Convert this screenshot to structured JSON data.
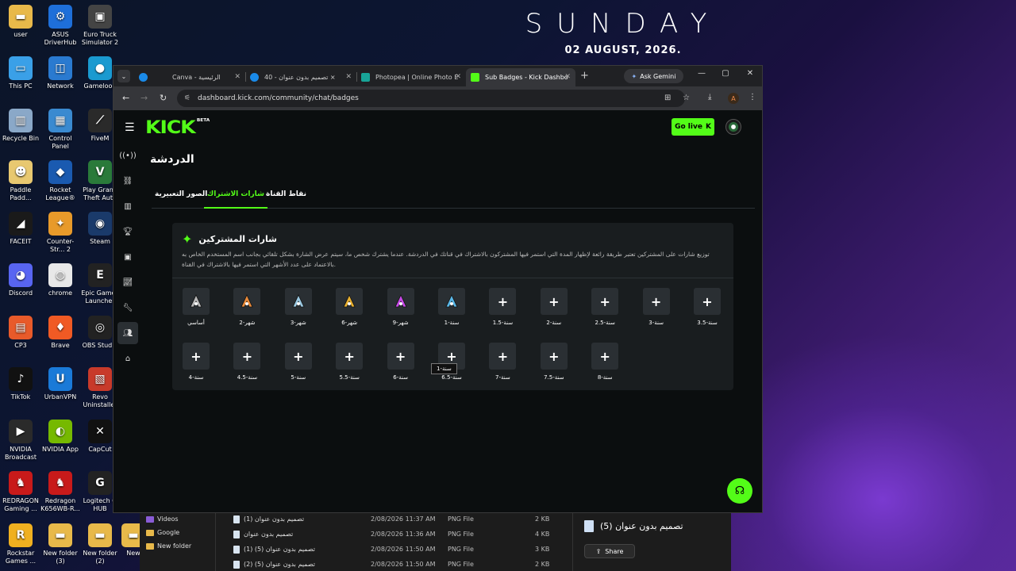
{
  "clock": {
    "day": "SUNDAY",
    "date": "02 AUGUST, 2026."
  },
  "desktop_icons": [
    {
      "label": "user",
      "color": "#e8b94a",
      "glyph": "▬"
    },
    {
      "label": "ASUS DriverHub",
      "color": "#1e6fd9",
      "glyph": "⚙"
    },
    {
      "label": "Euro Truck Simulator 2",
      "color": "#444",
      "glyph": "▣"
    },
    {
      "label": "This PC",
      "color": "#3aa0e8",
      "glyph": "▭"
    },
    {
      "label": "Network",
      "color": "#2a7ad0",
      "glyph": "◫"
    },
    {
      "label": "Gameloop",
      "color": "#1a9ad0",
      "glyph": "●"
    },
    {
      "label": "Recycle Bin",
      "color": "#8aa8c8",
      "glyph": "▥"
    },
    {
      "label": "Control Panel",
      "color": "#3a8ad0",
      "glyph": "▦"
    },
    {
      "label": "FiveM",
      "color": "#2a2a2a",
      "glyph": "⟋"
    },
    {
      "label": "Paddle Padd...",
      "color": "#e8c870",
      "glyph": "☻"
    },
    {
      "label": "Rocket League®",
      "color": "#1a5ab0",
      "glyph": "◆"
    },
    {
      "label": "Play Grand Theft Auto",
      "color": "#2a7a3a",
      "glyph": "V"
    },
    {
      "label": "FACEIT",
      "color": "#1a1a1a",
      "glyph": "◢"
    },
    {
      "label": "Counter-Str... 2",
      "color": "#e89a2a",
      "glyph": "✦"
    },
    {
      "label": "Steam",
      "color": "#1a3a6a",
      "glyph": "◉"
    },
    {
      "label": "Discord",
      "color": "#5865f2",
      "glyph": "◕"
    },
    {
      "label": "chrome",
      "color": "#e8e8e8",
      "glyph": "◍"
    },
    {
      "label": "Epic Games Launcher",
      "color": "#222",
      "glyph": "E"
    },
    {
      "label": "CP3",
      "color": "#e85a2a",
      "glyph": "▤"
    },
    {
      "label": "Brave",
      "color": "#f05a24",
      "glyph": "♦"
    },
    {
      "label": "OBS Studio",
      "color": "#222",
      "glyph": "◎"
    },
    {
      "label": "TikTok",
      "color": "#111",
      "glyph": "♪"
    },
    {
      "label": "UrbanVPN",
      "color": "#1a7ad8",
      "glyph": "U"
    },
    {
      "label": "Revo Uninstaller",
      "color": "#c83a2a",
      "glyph": "▧"
    },
    {
      "label": "NVIDIA Broadcast",
      "color": "#2a2a2a",
      "glyph": "▶"
    },
    {
      "label": "NVIDIA App",
      "color": "#76b900",
      "glyph": "◐"
    },
    {
      "label": "CapCut",
      "color": "#111",
      "glyph": "✕"
    },
    {
      "label": "REDRAGON Gaming ...",
      "color": "#c81a1a",
      "glyph": "♞"
    },
    {
      "label": "Redragon K656WB-R...",
      "color": "#c81a1a",
      "glyph": "♞"
    },
    {
      "label": "Logitech G HUB",
      "color": "#222",
      "glyph": "G"
    },
    {
      "label": "Rockstar Games ...",
      "color": "#f0b020",
      "glyph": "R"
    },
    {
      "label": "New folder (3)",
      "color": "#e8b94a",
      "glyph": "▬"
    },
    {
      "label": "New folder (2)",
      "color": "#e8b94a",
      "glyph": "▬"
    },
    {
      "label": "New",
      "color": "#e8b94a",
      "glyph": "▬"
    }
  ],
  "explorer": {
    "nav": [
      "Videos",
      "Google",
      "New folder"
    ],
    "files": [
      {
        "name": "تصميم بدون عنوان (1)",
        "date": "2/08/2026 11:37 AM",
        "type": "PNG File",
        "size": "2 KB"
      },
      {
        "name": "تصميم بدون عنوان",
        "date": "2/08/2026 11:36 AM",
        "type": "PNG File",
        "size": "4 KB"
      },
      {
        "name": "تصميم بدون عنوان (5) (1)",
        "date": "2/08/2026 11:50 AM",
        "type": "PNG File",
        "size": "3 KB"
      },
      {
        "name": "تصميم بدون عنوان (5) (2)",
        "date": "2/08/2026 11:50 AM",
        "type": "PNG File",
        "size": "2 KB"
      }
    ],
    "preview_title": "تصميم بدون عنوان (5)",
    "share_label": "Share"
  },
  "browser": {
    "tabs": [
      {
        "title": "Canva - الرئيسية",
        "favicon": "#1a8ae8"
      },
      {
        "title": "تصميم بدون عنوان - 40 ×",
        "favicon": "#1a8ae8"
      },
      {
        "title": "Photopea | Online Photo E",
        "favicon": "#18a497"
      },
      {
        "title": "Sub Badges - Kick Dashbo",
        "favicon": "#53fc18"
      }
    ],
    "gemini_label": "Ask Gemini",
    "url": "dashboard.kick.com/community/chat/badges",
    "profile_initial": "A"
  },
  "kick": {
    "logo": "KICK",
    "logo_sup": "BETA",
    "go_live": "Go live",
    "page_title": "الدردشة",
    "tabs": [
      "نقاط القناة",
      "شارات الاشتراك",
      "الصور التعبيرية"
    ],
    "card_title": "شارات المشتركين",
    "card_desc": "توزيع شارات على المشتركين تعتبر طريقة رائعة لإظهار المدة التي استمر فيها المشتركون بالاشتراك في قناتك في الدردشة. عندما يشترك شخص ما، سيتم عرض الشارة بشكل تلقائي بجانب اسم المستخدم الخاص به بالاعتماد على عدد الأشهر التي استمر فيها بالاشتراك في القناة.",
    "badges_row1": [
      {
        "label": "أساسي",
        "color": "#b8b8b8"
      },
      {
        "label": "شهر-2",
        "color": "#e88a3a"
      },
      {
        "label": "شهر-3",
        "color": "#9ac8e0"
      },
      {
        "label": "شهر-6",
        "color": "#e8b030"
      },
      {
        "label": "شهر-9",
        "color": "#c84ae8"
      },
      {
        "label": "سنة-1",
        "color": "#5ab8e8"
      },
      {
        "label": "سنة-1.5",
        "color": ""
      },
      {
        "label": "سنة-2",
        "color": ""
      },
      {
        "label": "سنة-2.5",
        "color": ""
      },
      {
        "label": "سنة-3",
        "color": ""
      },
      {
        "label": "سنة-3.5",
        "color": ""
      }
    ],
    "badges_row2": [
      {
        "label": "سنة-4"
      },
      {
        "label": "سنة-4.5"
      },
      {
        "label": "سنة-5"
      },
      {
        "label": "سنة-5.5"
      },
      {
        "label": "سنة-6"
      },
      {
        "label": "سنة-6.5"
      },
      {
        "label": "سنة-7"
      },
      {
        "label": "سنة-7.5"
      },
      {
        "label": "سنة-8"
      }
    ],
    "tooltip": "سنة-1",
    "accent": "#53fc18"
  }
}
